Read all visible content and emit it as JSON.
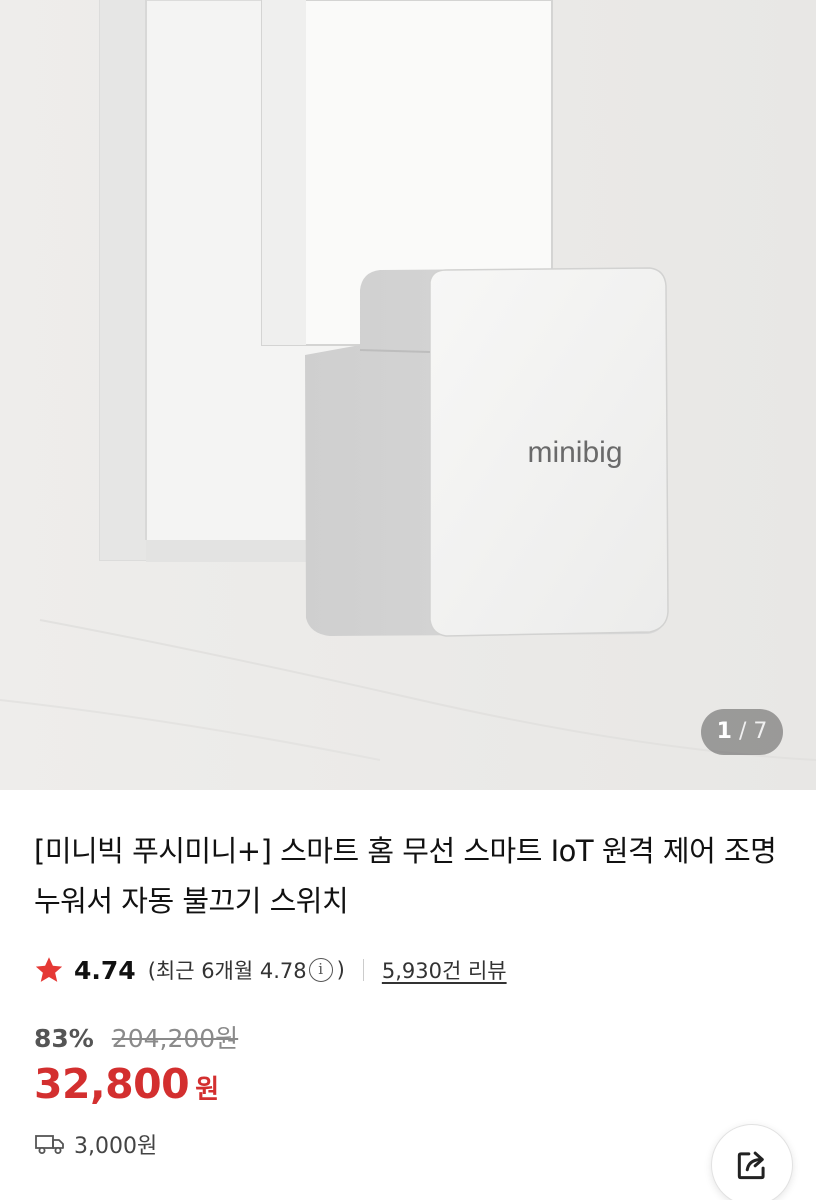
{
  "product": {
    "image": {
      "brand_text": "minibig",
      "counter_current": "1",
      "counter_separator": "/",
      "counter_total": "7"
    },
    "title": "[미니빅 푸시미니+] 스마트 홈 무선 스마트 IoT 원격 제어 조명 누워서 자동 불끄기 스위치",
    "rating": "4.74",
    "recent_rating": "(최근 6개월 4.78",
    "info_icon_glyph": "i",
    "recent_close": ")",
    "review_count": "5,930건 리뷰",
    "discount": "83%",
    "original_price": "204,200원",
    "price": "32,800",
    "currency": "원",
    "shipping_fee": "3,000원"
  },
  "icons": {
    "rating": "star-icon",
    "shipping": "truck-icon",
    "share": "share-icon",
    "info": "info-icon"
  },
  "colors": {
    "price": "#d32f2f",
    "star": "#e53935",
    "background": "#ffffff"
  }
}
